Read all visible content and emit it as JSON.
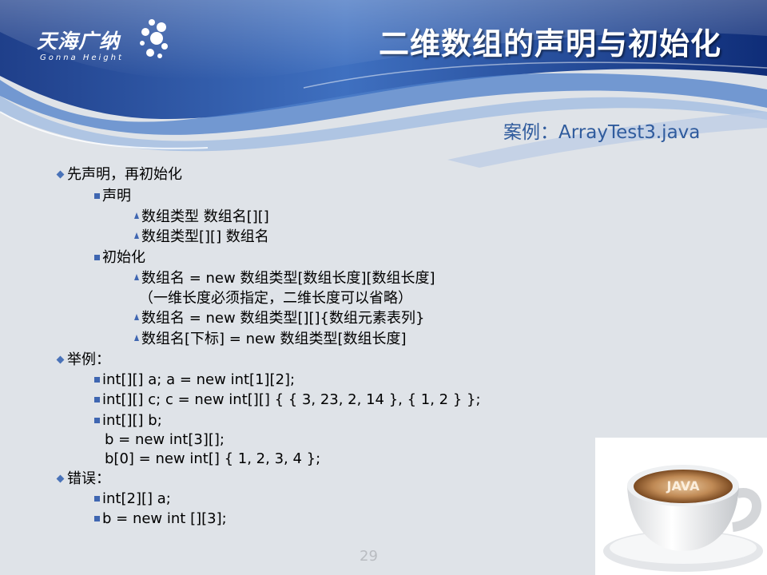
{
  "header": {
    "logo_cn": "天海广纳",
    "logo_en": "Gonna Height",
    "title": "二维数组的声明与初始化"
  },
  "case_ref": "案例：ArrayTest3.java",
  "content": {
    "l1": "先声明，再初始化",
    "l2": "声明",
    "l3": "数组类型  数组名[][]",
    "l4": "数组类型[][]  数组名",
    "l5": "初始化",
    "l6": "数组名 = new 数组类型[数组长度][数组长度]",
    "l7": "（一维长度必须指定，二维长度可以省略）",
    "l8": "数组名 = new 数组类型[][]{数组元素表列}",
    "l9": "数组名[下标] = new 数组类型[数组长度]",
    "l10": "举例：",
    "l11": "int[][] a;  a = new int[1][2];",
    "l12": "int[][] c;  c = new int[][] { { 3, 23, 2, 14 }, { 1, 2 } };",
    "l13": "int[][] b;",
    "l14": "b = new int[3][];",
    "l15": "b[0] = new int[] { 1, 2, 3, 4 };",
    "l16": "错误：",
    "l17": "int[2][] a;",
    "l18": "b = new int [][3];"
  },
  "cup_text": "JAVA",
  "page_number": "29"
}
